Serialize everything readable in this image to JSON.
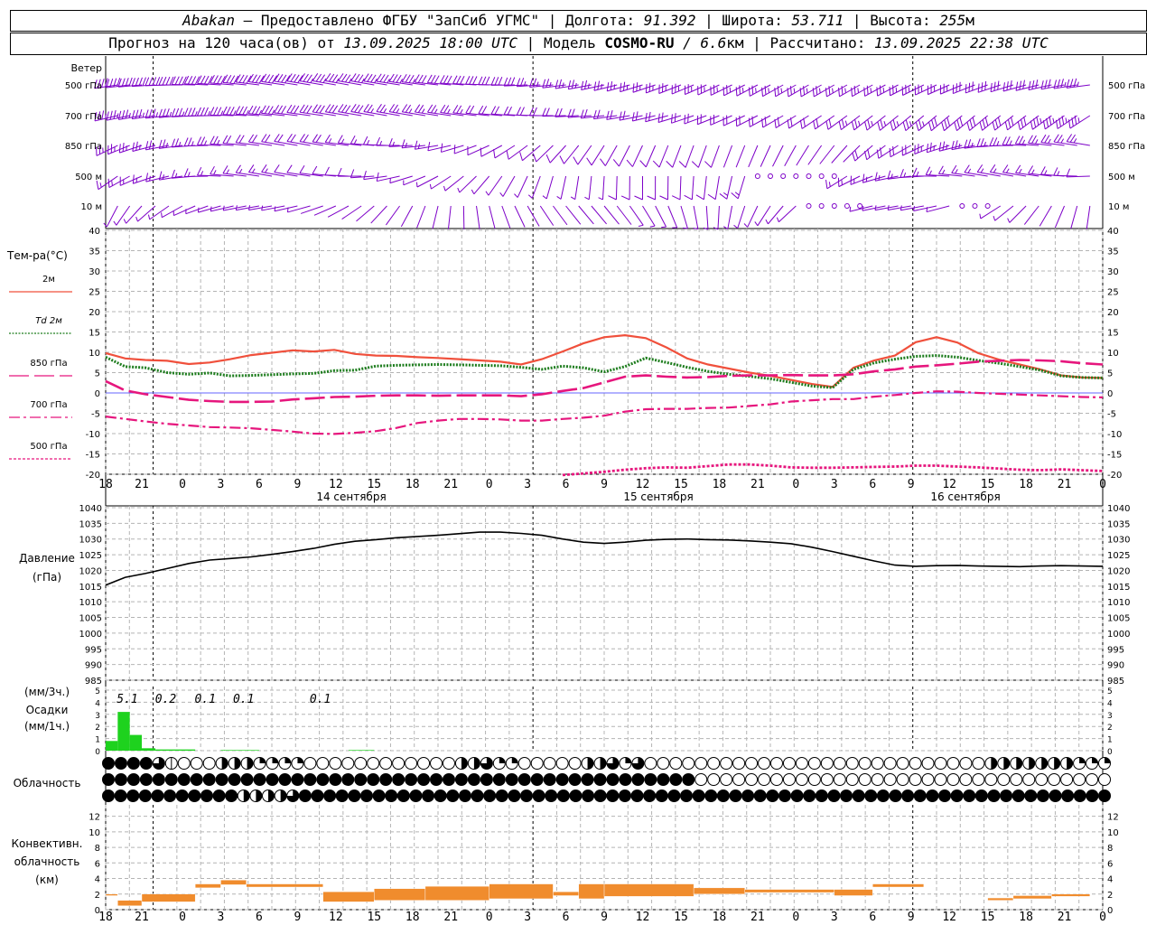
{
  "header": {
    "station": "Abakan",
    "provider": "— Предоставлено ФГБУ \"ЗапСиб УГМС\"",
    "lon_label": "Долгота:",
    "lon": "91.392",
    "lat_label": "Широта:",
    "lat": "53.711",
    "alt_label": "Высота:",
    "alt": "255",
    "alt_unit": "м",
    "forecast_label": "Прогноз на 120 часа(ов) от",
    "forecast_start": "13.09.2025 18:00 UTC",
    "model_label": "Модель",
    "model": "COSMO-RU",
    "model_res": "/ 6.6",
    "model_res_unit": "км",
    "calc_label": "Рассчитано:",
    "calc_time": "13.09.2025 22:38 UTC"
  },
  "colors": {
    "wind": "#7d00c8",
    "t2m": "#f0503c",
    "td2m": "#1e7d1e",
    "t850": "#e6167d",
    "t700": "#e6167d",
    "t500": "#e6167d",
    "pressure": "#000000",
    "precip": "#1ed21e",
    "conv": "#f08c2d",
    "grid": "#b4b4b4"
  },
  "time_axis": {
    "hours_labels": [
      "18",
      "21",
      "0",
      "3",
      "6",
      "9",
      "12",
      "15",
      "18",
      "21",
      "0",
      "3",
      "6",
      "9",
      "12",
      "15",
      "18",
      "21",
      "0",
      "3",
      "6",
      "9",
      "12",
      "15",
      "18",
      "21",
      "0"
    ],
    "day_labels": [
      "14 сентября",
      "15 сентября",
      "16 сентября"
    ]
  },
  "wind": {
    "title": "Ветер",
    "levels": [
      "500 гПа",
      "700 гПа",
      "850 гПа",
      "500 м",
      "10  м"
    ]
  },
  "chart_data": [
    {
      "type": "line",
      "title": "Тем-ра(°C)",
      "ylim": [
        -20,
        40
      ],
      "yticks": [
        -20,
        -15,
        -10,
        -5,
        0,
        5,
        10,
        15,
        20,
        25,
        30,
        35,
        40
      ],
      "x_hours": [
        0,
        3,
        6,
        9,
        12,
        15,
        18,
        21,
        24,
        27,
        30,
        33,
        36,
        39,
        42,
        45,
        48,
        51,
        54,
        57,
        60,
        63,
        66,
        69,
        72,
        75,
        78,
        81,
        84,
        87,
        90,
        93,
        96,
        99,
        102,
        105,
        108,
        111,
        114,
        117,
        120,
        123,
        126
      ],
      "series": [
        {
          "name": "2м",
          "style": "solid",
          "values": [
            9.8,
            8.5,
            8.1,
            7.9,
            7.1,
            7.5,
            8.3,
            9.3,
            9.9,
            10.5,
            10.2,
            10.6,
            9.6,
            9.2,
            9.1,
            8.8,
            8.6,
            8.3,
            8.0,
            7.7,
            7.0,
            8.3,
            10.2,
            12.2,
            13.7,
            14.2,
            13.5,
            11.2,
            8.5,
            7.0,
            6.0,
            5.0,
            4.2,
            3.2,
            2.2,
            1.5,
            6.2,
            8.0,
            9.2,
            12.5,
            13.7,
            12.4,
            9.8,
            8.2,
            7.0,
            5.8,
            4.3,
            3.8,
            3.7
          ]
        },
        {
          "name": "Td  2м",
          "style": "dotted",
          "values": [
            8.8,
            6.5,
            6.2,
            5.0,
            4.6,
            4.9,
            4.2,
            4.3,
            4.5,
            4.7,
            4.8,
            5.5,
            5.6,
            6.6,
            6.8,
            6.9,
            7.0,
            6.9,
            6.8,
            6.7,
            6.3,
            5.8,
            6.6,
            6.2,
            5.2,
            6.5,
            8.6,
            7.5,
            6.3,
            5.3,
            4.6,
            4.1,
            3.5,
            2.6,
            1.7,
            1.3,
            5.8,
            7.4,
            8.3,
            9.0,
            9.2,
            8.8,
            8.0,
            7.3,
            6.5,
            5.6,
            4.2,
            3.8,
            3.7
          ]
        },
        {
          "name": "850 гПа",
          "style": "longdash",
          "values": [
            2.9,
            0.6,
            -0.3,
            -1.0,
            -1.7,
            -2.0,
            -2.2,
            -2.2,
            -2.1,
            -1.6,
            -1.3,
            -1.0,
            -0.9,
            -0.7,
            -0.6,
            -0.6,
            -0.7,
            -0.6,
            -0.6,
            -0.6,
            -0.8,
            -0.3,
            0.5,
            1.2,
            2.6,
            4.0,
            4.3,
            4.0,
            3.8,
            3.9,
            4.2,
            4.3,
            4.3,
            4.4,
            4.3,
            4.3,
            4.6,
            5.3,
            5.8,
            6.5,
            6.8,
            7.2,
            7.7,
            7.9,
            8.1,
            8.0,
            7.8,
            7.3,
            7.0
          ]
        },
        {
          "name": "700 гПа",
          "style": "dashdot",
          "values": [
            -5.8,
            -6.4,
            -7.0,
            -7.6,
            -8.0,
            -8.4,
            -8.5,
            -8.7,
            -9.1,
            -9.5,
            -10.0,
            -10.1,
            -9.8,
            -9.4,
            -8.6,
            -7.4,
            -6.8,
            -6.4,
            -6.4,
            -6.5,
            -6.8,
            -6.8,
            -6.4,
            -6.1,
            -5.6,
            -4.6,
            -4.0,
            -3.9,
            -3.9,
            -3.7,
            -3.6,
            -3.2,
            -2.8,
            -2.1,
            -1.8,
            -1.5,
            -1.5,
            -0.9,
            -0.5,
            0.0,
            0.4,
            0.3,
            0.0,
            -0.2,
            -0.4,
            -0.6,
            -0.8,
            -1.0,
            -1.1
          ]
        },
        {
          "name": "500 гПа",
          "style": "shortdash",
          "values": [
            null,
            null,
            null,
            null,
            null,
            null,
            null,
            null,
            null,
            null,
            null,
            null,
            null,
            null,
            null,
            null,
            null,
            null,
            null,
            null,
            null,
            null,
            -20.2,
            -19.8,
            -19.4,
            -18.9,
            -18.5,
            -18.3,
            -18.4,
            -18.0,
            -17.6,
            -17.6,
            -17.9,
            -18.3,
            -18.4,
            -18.4,
            -18.3,
            -18.2,
            -18.1,
            -17.9,
            -17.9,
            -18.1,
            -18.3,
            -18.6,
            -18.9,
            -19.0,
            -18.8,
            -19.0,
            -19.2
          ]
        }
      ]
    },
    {
      "type": "line",
      "title": "Давление",
      "unit": "(гПа)",
      "ylim": [
        985,
        1040
      ],
      "yticks": [
        985,
        990,
        995,
        1000,
        1005,
        1010,
        1015,
        1020,
        1025,
        1030,
        1035,
        1040
      ],
      "series": [
        {
          "name": "Давление",
          "values": [
            1015.3,
            1017.8,
            1019.0,
            1020.6,
            1022.2,
            1023.3,
            1023.8,
            1024.3,
            1025.1,
            1026.0,
            1027.0,
            1028.3,
            1029.3,
            1029.8,
            1030.4,
            1030.8,
            1031.2,
            1031.7,
            1032.2,
            1032.2,
            1031.8,
            1031.2,
            1030.0,
            1029.0,
            1028.6,
            1029.0,
            1029.6,
            1029.9,
            1030.0,
            1029.8,
            1029.7,
            1029.4,
            1029.0,
            1028.5,
            1027.4,
            1026.0,
            1024.5,
            1023.0,
            1021.7,
            1021.3,
            1021.5,
            1021.6,
            1021.4,
            1021.3,
            1021.2,
            1021.4,
            1021.5,
            1021.4,
            1021.3
          ]
        }
      ]
    },
    {
      "type": "bar",
      "title": "Осадки",
      "unit_3h": "(мм/3ч.)",
      "unit_1h": "(мм/1ч.)",
      "ylim": [
        0,
        5
      ],
      "yticks": [
        0,
        1,
        2,
        3,
        4,
        5
      ],
      "values_1h": [
        0.8,
        3.2,
        1.3,
        0.2,
        0.1,
        0.1,
        0.1,
        0,
        0,
        0.05,
        0.05,
        0.05,
        0,
        0,
        0,
        0,
        0,
        0,
        0,
        0.05,
        0.05,
        0,
        0,
        0,
        0,
        0
      ],
      "labels_3h": [
        {
          "hour": 3,
          "text": "5.1"
        },
        {
          "hour": 6,
          "text": "0.2"
        },
        {
          "hour": 9,
          "text": "0.1"
        },
        {
          "hour": 12,
          "text": "0.1"
        },
        {
          "hour": 18,
          "text": "0.1"
        }
      ]
    },
    {
      "type": "heatmap",
      "title": "Облачность",
      "rows": [
        "fffftpeeehhhqqqqeeeeeeeeeeeehhtqqeeeeehhtqteeeeeeeeeeeeeeeeeeeeeeeeeeehhhhhhhqqq",
        "fffffffffffffffffffffffffffffffffffffffffffffffeeeeeeeeeeeeeeeeeeeeeeeeeeeeeeeee",
        "fffffffffffhhhhtffffffffffffffffffffffffffffffffffffffffffffffffffffffffffffffffff"
      ]
    },
    {
      "type": "bar",
      "title": "Конвективн. облачность",
      "unit": "(км)",
      "ylim": [
        0,
        13
      ],
      "yticks": [
        0,
        2,
        4,
        6,
        8,
        10,
        12
      ],
      "segments": [
        {
          "h0": 0,
          "h1": 1,
          "base": 1.8,
          "top": 2.0
        },
        {
          "h0": 1,
          "h1": 3,
          "base": 0.5,
          "top": 1.2
        },
        {
          "h0": 3,
          "h1": 7,
          "base": 1.0,
          "top": 2.0
        },
        {
          "h0": 7,
          "h1": 9,
          "base": 2.8,
          "top": 3.3
        },
        {
          "h0": 9,
          "h1": 11,
          "base": 3.2,
          "top": 3.8
        },
        {
          "h0": 11,
          "h1": 17,
          "base": 2.9,
          "top": 3.3
        },
        {
          "h0": 17,
          "h1": 21,
          "base": 1.0,
          "top": 2.3
        },
        {
          "h0": 21,
          "h1": 25,
          "base": 1.2,
          "top": 2.7
        },
        {
          "h0": 25,
          "h1": 30,
          "base": 1.2,
          "top": 3.0
        },
        {
          "h0": 30,
          "h1": 35,
          "base": 1.4,
          "top": 3.3
        },
        {
          "h0": 35,
          "h1": 37,
          "base": 1.8,
          "top": 2.3
        },
        {
          "h0": 37,
          "h1": 39,
          "base": 1.4,
          "top": 3.3
        },
        {
          "h0": 39,
          "h1": 46,
          "base": 1.7,
          "top": 3.3
        },
        {
          "h0": 46,
          "h1": 50,
          "base": 2.0,
          "top": 2.8
        },
        {
          "h0": 50,
          "h1": 57,
          "base": 2.2,
          "top": 2.6
        },
        {
          "h0": 57,
          "h1": 60,
          "base": 1.8,
          "top": 2.6
        },
        {
          "h0": 60,
          "h1": 64,
          "base": 2.9,
          "top": 3.3
        },
        {
          "h0": 69,
          "h1": 71,
          "base": 1.2,
          "top": 1.5
        },
        {
          "h0": 71,
          "h1": 74,
          "base": 1.4,
          "top": 1.8
        },
        {
          "h0": 74,
          "h1": 77,
          "base": 1.7,
          "top": 2.0
        },
        {
          "h0": 101,
          "h1": 105,
          "base": 0.5,
          "top": 0.7
        },
        {
          "h0": 125,
          "h1": 126,
          "base": 0.1,
          "top": 0.4
        }
      ]
    }
  ]
}
